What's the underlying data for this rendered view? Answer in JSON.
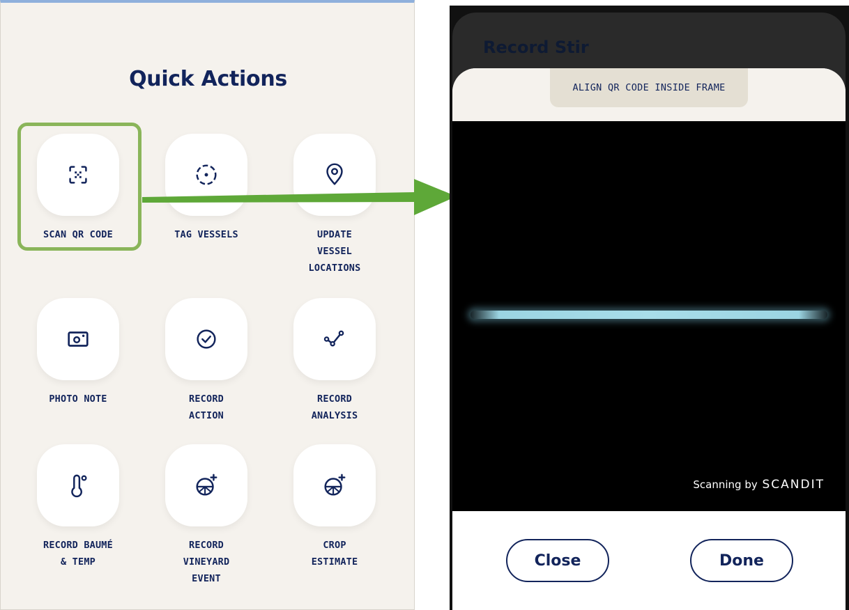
{
  "quick_actions": {
    "title": "Quick Actions",
    "tiles": [
      {
        "label": "SCAN QR CODE",
        "icon": "scan-qr-icon"
      },
      {
        "label": "TAG VESSELS",
        "icon": "tag-target-icon"
      },
      {
        "label": "UPDATE\nVESSEL\nLOCATIONS",
        "icon": "location-pin-icon"
      },
      {
        "label": "PHOTO NOTE",
        "icon": "camera-icon"
      },
      {
        "label": "RECORD\nACTION",
        "icon": "check-circle-icon"
      },
      {
        "label": "RECORD\nANALYSIS",
        "icon": "analysis-graph-icon"
      },
      {
        "label": "RECORD BAUMÉ\n& TEMP",
        "icon": "thermometer-icon"
      },
      {
        "label": "RECORD\nVINEYARD\nEVENT",
        "icon": "vineyard-add-icon"
      },
      {
        "label": "CROP\nESTIMATE",
        "icon": "crop-add-icon"
      }
    ]
  },
  "scanner": {
    "background_title": "Record Stir",
    "instruction": "ALIGN QR CODE INSIDE FRAME",
    "powered_prefix": "Scanning by",
    "powered_brand": "SCANDIT",
    "close_label": "Close",
    "done_label": "Done"
  },
  "colors": {
    "navy": "#12245b",
    "highlight": "#8ab55a",
    "arrow": "#5ea838",
    "panel_bg": "#f5f2ed"
  }
}
